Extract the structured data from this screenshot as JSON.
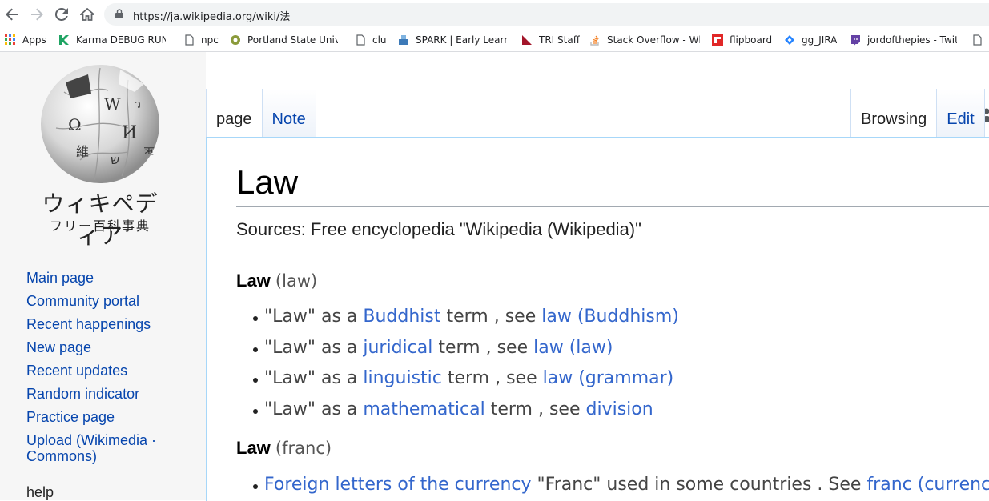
{
  "browser": {
    "url": "https://ja.wikipedia.org/wiki/法",
    "bookmarks": [
      {
        "label": "Apps"
      },
      {
        "label": "Karma DEBUG RUNN"
      },
      {
        "label": "npc"
      },
      {
        "label": "Portland State Univer"
      },
      {
        "label": "clu"
      },
      {
        "label": "SPARK | Early Learning"
      },
      {
        "label": "TRI Staff"
      },
      {
        "label": "Stack Overflow - Whe"
      },
      {
        "label": "flipboard"
      },
      {
        "label": "gg_JIRA"
      },
      {
        "label": "jordofthepies - Twitch"
      }
    ]
  },
  "logo": {
    "title": "ウィキペディア",
    "subtitle": "フリー百科事典"
  },
  "sidebar": {
    "items": [
      "Main page",
      "Community portal",
      "Recent happenings",
      "New page",
      "Recent updates",
      "Random indicator",
      "Practice page",
      "Upload (Wikimedia · Commons)"
    ],
    "help": "help"
  },
  "tabs": {
    "page": "page",
    "note": "Note",
    "browsing": "Browsing",
    "edit": "Edit"
  },
  "article": {
    "title": "Law",
    "source": "Sources: Free encyclopedia \"Wikipedia (Wikipedia)\"",
    "section1": {
      "word": "Law",
      "paren": "(law)"
    },
    "items1": [
      {
        "pre": "\"Law\" as a ",
        "link1": "Buddhist",
        "mid": " term , see ",
        "link2": "law (Buddhism)"
      },
      {
        "pre": "\"Law\" as a ",
        "link1": "juridical",
        "mid": " term , see ",
        "link2": "law (law)"
      },
      {
        "pre": "\"Law\" as a ",
        "link1": "linguistic",
        "mid": " term , see ",
        "link2": "law (grammar)"
      },
      {
        "pre": "\"Law\" as a ",
        "link1": "mathematical",
        "mid": " term , see ",
        "link2": "division"
      }
    ],
    "section2": {
      "word": "Law",
      "paren": "(franc)"
    },
    "item2": {
      "link1": "Foreign letters of the currency",
      "mid": " \"Franc\" used in some countries . See ",
      "link2": "franc (currency)",
      "post": " ."
    }
  },
  "colors": {
    "link": "#0645ad",
    "content_link": "#3366cc",
    "border": "#a7d7f9"
  }
}
